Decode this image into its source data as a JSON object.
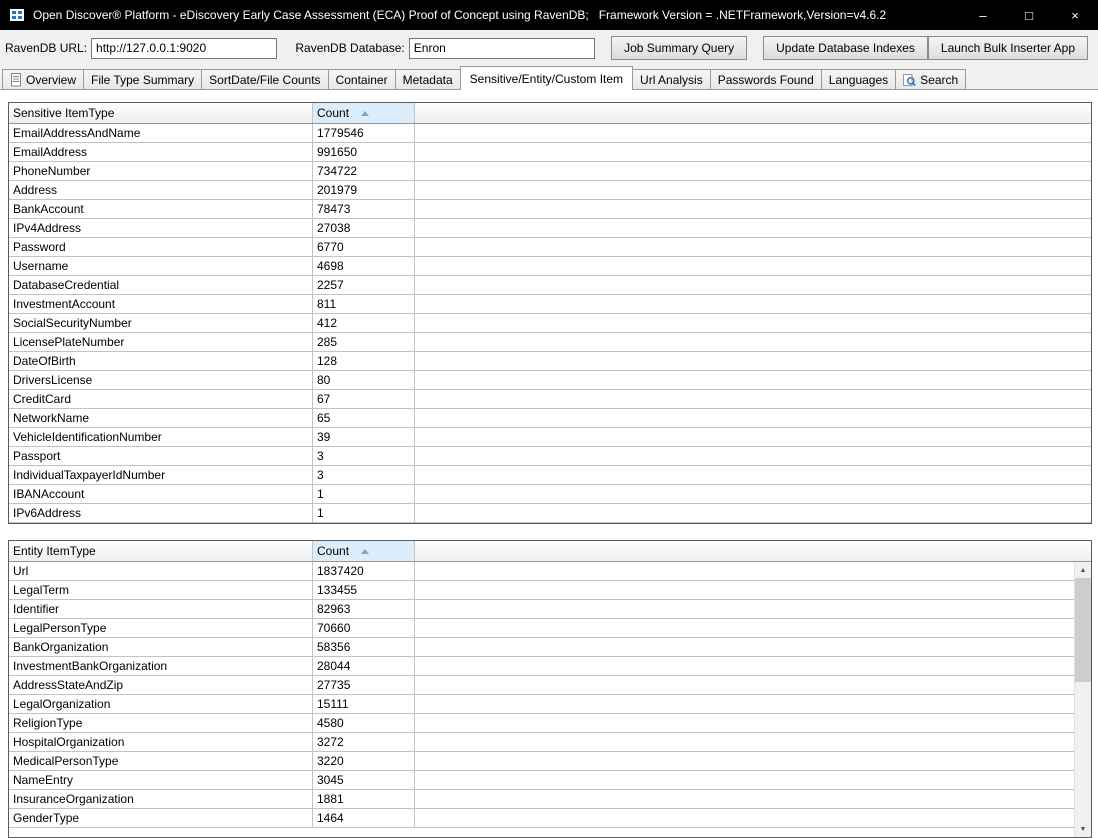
{
  "window": {
    "title": "Open Discover® Platform - eDiscovery Early Case Assessment (ECA) Proof of Concept using RavenDB;   Framework Version = .NETFramework,Version=v4.6.2",
    "minimize_glyph": "–",
    "maximize_glyph": "□",
    "close_glyph": "×"
  },
  "toolbar": {
    "url_label": "RavenDB URL:",
    "url_value": "http://127.0.0.1:9020",
    "database_label": "RavenDB Database:",
    "database_value": "Enron",
    "job_summary_button": "Job Summary Query",
    "update_indexes_button": "Update Database Indexes",
    "bulk_inserter_button": "Launch Bulk Inserter App"
  },
  "tabs": [
    {
      "label": "Overview"
    },
    {
      "label": "File Type Summary"
    },
    {
      "label": "SortDate/File Counts"
    },
    {
      "label": "Container"
    },
    {
      "label": "Metadata"
    },
    {
      "label": "Sensitive/Entity/Custom Item",
      "selected": true
    },
    {
      "label": "Url Analysis"
    },
    {
      "label": "Passwords Found"
    },
    {
      "label": "Languages"
    },
    {
      "label": "Search"
    }
  ],
  "sensitive_grid": {
    "columns": [
      "Sensitive ItemType",
      "Count"
    ],
    "sorted_column": "Count",
    "rows": [
      [
        "EmailAddressAndName",
        "1779546"
      ],
      [
        "EmailAddress",
        "991650"
      ],
      [
        "PhoneNumber",
        "734722"
      ],
      [
        "Address",
        "201979"
      ],
      [
        "BankAccount",
        "78473"
      ],
      [
        "IPv4Address",
        "27038"
      ],
      [
        "Password",
        "6770"
      ],
      [
        "Username",
        "4698"
      ],
      [
        "DatabaseCredential",
        "2257"
      ],
      [
        "InvestmentAccount",
        "811"
      ],
      [
        "SocialSecurityNumber",
        "412"
      ],
      [
        "LicensePlateNumber",
        "285"
      ],
      [
        "DateOfBirth",
        "128"
      ],
      [
        "DriversLicense",
        "80"
      ],
      [
        "CreditCard",
        "67"
      ],
      [
        "NetworkName",
        "65"
      ],
      [
        "VehicleIdentificationNumber",
        "39"
      ],
      [
        "Passport",
        "3"
      ],
      [
        "IndividualTaxpayerIdNumber",
        "3"
      ],
      [
        "IBANAccount",
        "1"
      ],
      [
        "IPv6Address",
        "1"
      ]
    ]
  },
  "entity_grid": {
    "columns": [
      "Entity ItemType",
      "Count"
    ],
    "sorted_column": "Count",
    "rows": [
      [
        "Url",
        "1837420"
      ],
      [
        "LegalTerm",
        "133455"
      ],
      [
        "Identifier",
        "82963"
      ],
      [
        "LegalPersonType",
        "70660"
      ],
      [
        "BankOrganization",
        "58356"
      ],
      [
        "InvestmentBankOrganization",
        "28044"
      ],
      [
        "AddressStateAndZip",
        "27735"
      ],
      [
        "LegalOrganization",
        "15111"
      ],
      [
        "ReligionType",
        "4580"
      ],
      [
        "HospitalOrganization",
        "3272"
      ],
      [
        "MedicalPersonType",
        "3220"
      ],
      [
        "NameEntry",
        "3045"
      ],
      [
        "InsuranceOrganization",
        "1881"
      ],
      [
        "GenderType",
        "1464"
      ]
    ]
  },
  "scrollbar": {
    "up_glyph": "▲",
    "down_glyph": "▼"
  }
}
